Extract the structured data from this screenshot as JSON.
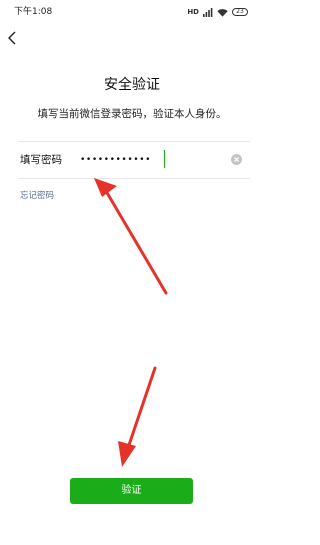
{
  "status_bar": {
    "time": "下午1:08",
    "network_label": "HD",
    "battery_level": "23"
  },
  "navigation": {
    "back_icon": "chevron-left-icon"
  },
  "header": {
    "title": "安全验证",
    "subtitle": "填写当前微信登录密码，验证本人身份。"
  },
  "password_field": {
    "label": "填写密码",
    "value": "••••••••••••",
    "clear_icon": "clear-circle-icon"
  },
  "forgot_password_link": "忘记密码",
  "verify_button_label": "验证",
  "colors": {
    "brand_green": "#1aad19",
    "link_blue": "#576b95",
    "annotation_red": "#e53329"
  }
}
